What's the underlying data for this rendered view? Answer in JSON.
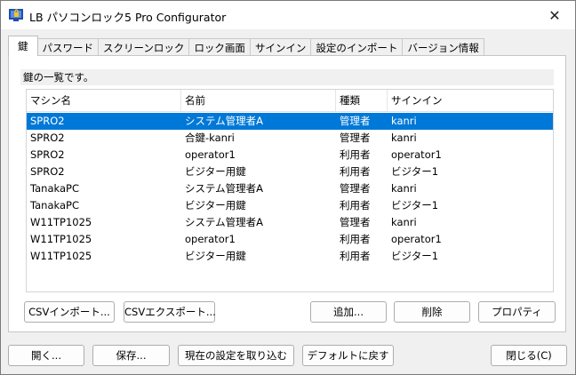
{
  "window": {
    "title": "LB パソコンロック5 Pro Configurator",
    "close_glyph": "✕"
  },
  "tabs": [
    {
      "label": "鍵",
      "active": true
    },
    {
      "label": "パスワード"
    },
    {
      "label": "スクリーンロック"
    },
    {
      "label": "ロック画面"
    },
    {
      "label": "サインイン"
    },
    {
      "label": "設定のインポート"
    },
    {
      "label": "バージョン情報"
    }
  ],
  "panel": {
    "description": "鍵の一覧です。"
  },
  "table": {
    "columns": [
      "マシン名",
      "名前",
      "種類",
      "サインイン"
    ],
    "rows": [
      [
        "SPRO2",
        "システム管理者A",
        "管理者",
        "kanri"
      ],
      [
        "SPRO2",
        "合鍵-kanri",
        "管理者",
        "kanri"
      ],
      [
        "SPRO2",
        "operator1",
        "利用者",
        "operator1"
      ],
      [
        "SPRO2",
        "ビジター用鍵",
        "利用者",
        "ビジター1"
      ],
      [
        "TanakaPC",
        "システム管理者A",
        "管理者",
        "kanri"
      ],
      [
        "TanakaPC",
        "ビジター用鍵",
        "利用者",
        "ビジター1"
      ],
      [
        "W11TP1025",
        "システム管理者A",
        "管理者",
        "kanri"
      ],
      [
        "W11TP1025",
        "operator1",
        "利用者",
        "operator1"
      ],
      [
        "W11TP1025",
        "ビジター用鍵",
        "利用者",
        "ビジター1"
      ]
    ],
    "selected_row": 0
  },
  "panel_buttons": {
    "csv_import": "CSVインポート...",
    "csv_export": "CSVエクスポート...",
    "add": "追加...",
    "delete": "削除",
    "properties": "プロパティ"
  },
  "footer_buttons": {
    "open": "開く...",
    "save": "保存...",
    "load_current": "現在の設定を取り込む",
    "reset_default": "デフォルトに戻す",
    "close": "閉じる(C)"
  },
  "colors": {
    "selection": "#0078d7",
    "window_bg": "#f0f0f0"
  }
}
